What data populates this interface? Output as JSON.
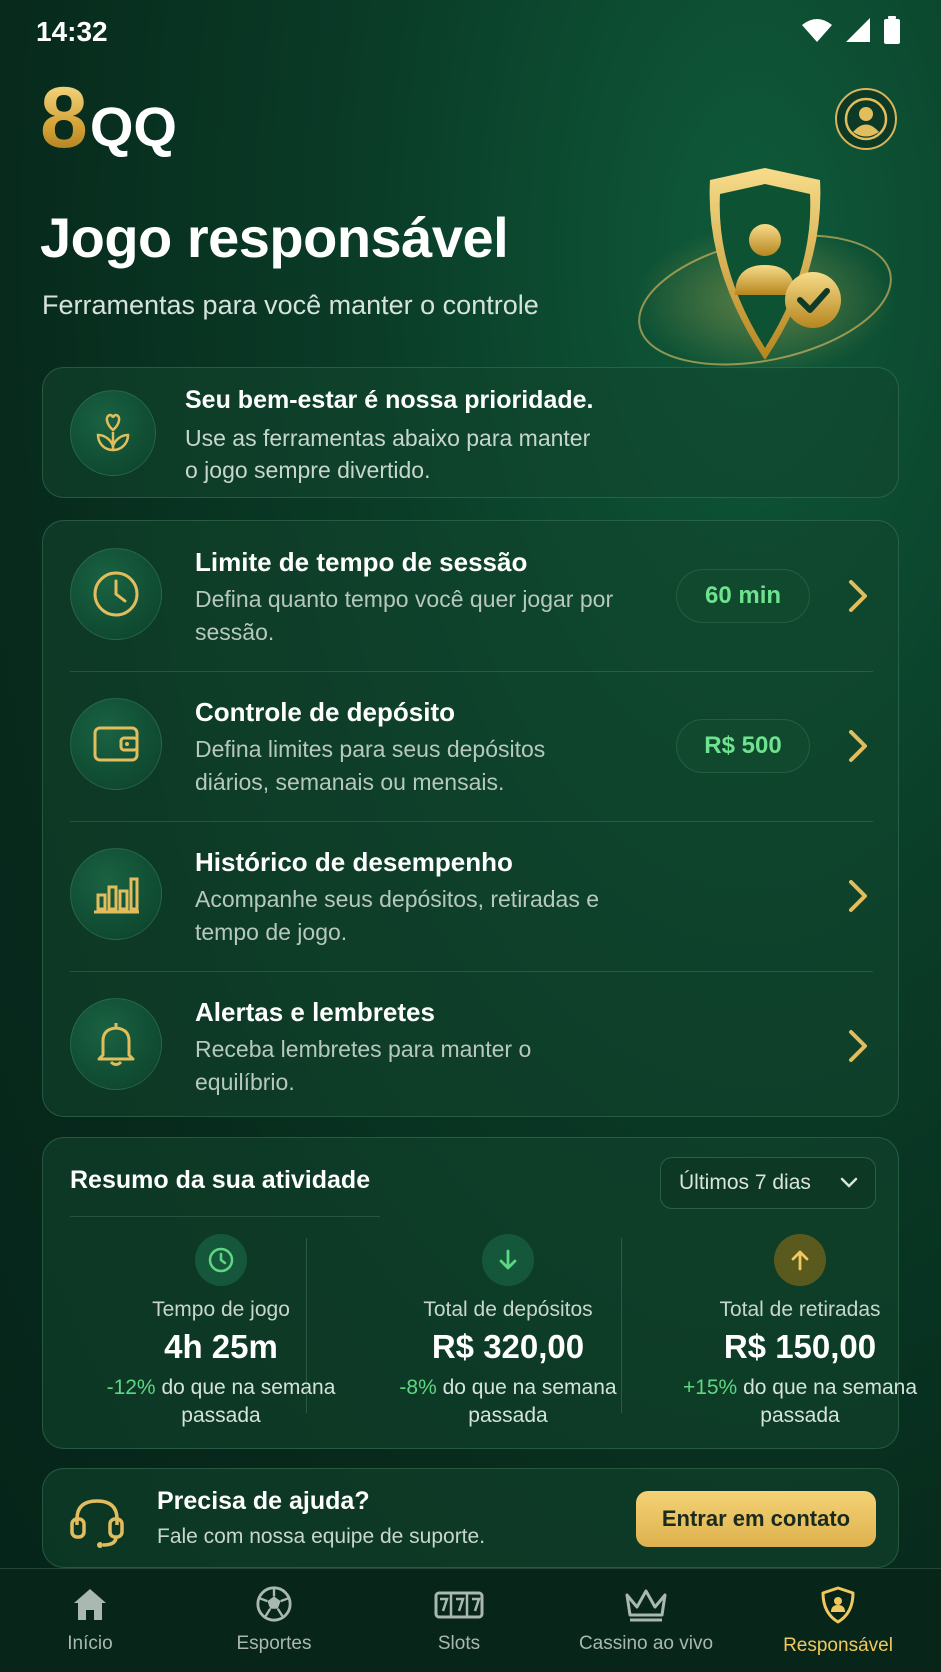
{
  "status_bar": {
    "time": "14:32"
  },
  "header": {
    "logo_number": "8",
    "logo_text": "QQ"
  },
  "hero": {
    "title": "Jogo responsável",
    "subtitle": "Ferramentas para você manter o controle"
  },
  "wellbeing": {
    "title": "Seu bem-estar é nossa prioridade.",
    "text": "Use as ferramentas abaixo para manter o jogo sempre divertido."
  },
  "tools": [
    {
      "title": "Limite de tempo de sessão",
      "desc": "Defina quanto tempo você quer jogar por sessão.",
      "value": "60 min",
      "icon": "clock-icon"
    },
    {
      "title": "Controle de depósito",
      "desc": "Defina limites para seus depósitos diários, semanais ou mensais.",
      "value": "R$ 500",
      "icon": "wallet-icon"
    },
    {
      "title": "Histórico de desempenho",
      "desc": "Acompanhe seus depósitos, retiradas e tempo de jogo.",
      "icon": "bar-chart-icon"
    },
    {
      "title": "Alertas e lembretes",
      "desc": "Receba lembretes para manter o equilíbrio.",
      "icon": "bell-icon"
    }
  ],
  "activity": {
    "title": "Resumo da sua atividade",
    "period": "Últimos 7 dias",
    "stats": [
      {
        "label": "Tempo de jogo",
        "value": "4h 25m",
        "change": "-12%",
        "suffix": " do que na semana passada",
        "icon": "clock-icon"
      },
      {
        "label": "Total de depósitos",
        "value": "R$ 320,00",
        "change": "-8%",
        "suffix": " do que na semana passada",
        "icon": "arrow-down-icon"
      },
      {
        "label": "Total de retiradas",
        "value": "R$ 150,00",
        "change": "+15%",
        "suffix": " do que na semana passada",
        "icon": "arrow-up-icon"
      }
    ]
  },
  "help": {
    "title": "Precisa de ajuda?",
    "text": "Fale com nossa equipe de suporte.",
    "button": "Entrar em contato"
  },
  "nav": [
    {
      "label": "Início",
      "icon": "home-icon"
    },
    {
      "label": "Esportes",
      "icon": "soccer-ball-icon"
    },
    {
      "label": "Slots",
      "icon": "slots-icon"
    },
    {
      "label": "Cassino ao vivo",
      "icon": "crown-icon"
    },
    {
      "label": "Responsável",
      "icon": "shield-icon",
      "active": true
    }
  ],
  "colors": {
    "gold": "#e8bf59",
    "green_accent": "#5fd782",
    "bg": "#072a1c"
  }
}
